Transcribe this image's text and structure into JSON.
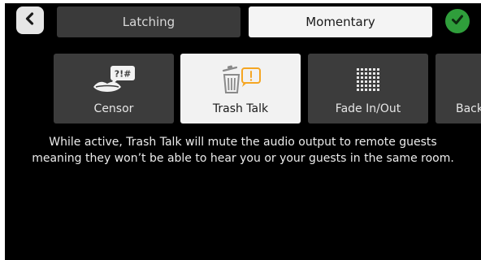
{
  "header": {
    "back_icon": "chevron-left-icon",
    "modes": [
      {
        "label": "Latching",
        "selected": false
      },
      {
        "label": "Momentary",
        "selected": true
      }
    ],
    "confirm_icon": "checkmark-icon",
    "confirm_color": "#2f9e3b"
  },
  "effects": [
    {
      "label": "Censor",
      "icon": "lips-censor-icon",
      "selected": false
    },
    {
      "label": "Trash Talk",
      "icon": "trash-talk-icon",
      "selected": true
    },
    {
      "label": "Fade In/Out",
      "icon": "fade-grid-icon",
      "selected": false
    },
    {
      "label": "Back",
      "icon": "",
      "selected": false
    }
  ],
  "description": {
    "line1": "While active, Trash Talk will mute the audio output to remote guests",
    "line2": "meaning they won’t be able to hear you or your guests in the same room."
  },
  "colors": {
    "background": "#000000",
    "tile": "#3c3c3c",
    "tile_selected": "#f2f2f2",
    "accent_orange": "#f5a623"
  }
}
